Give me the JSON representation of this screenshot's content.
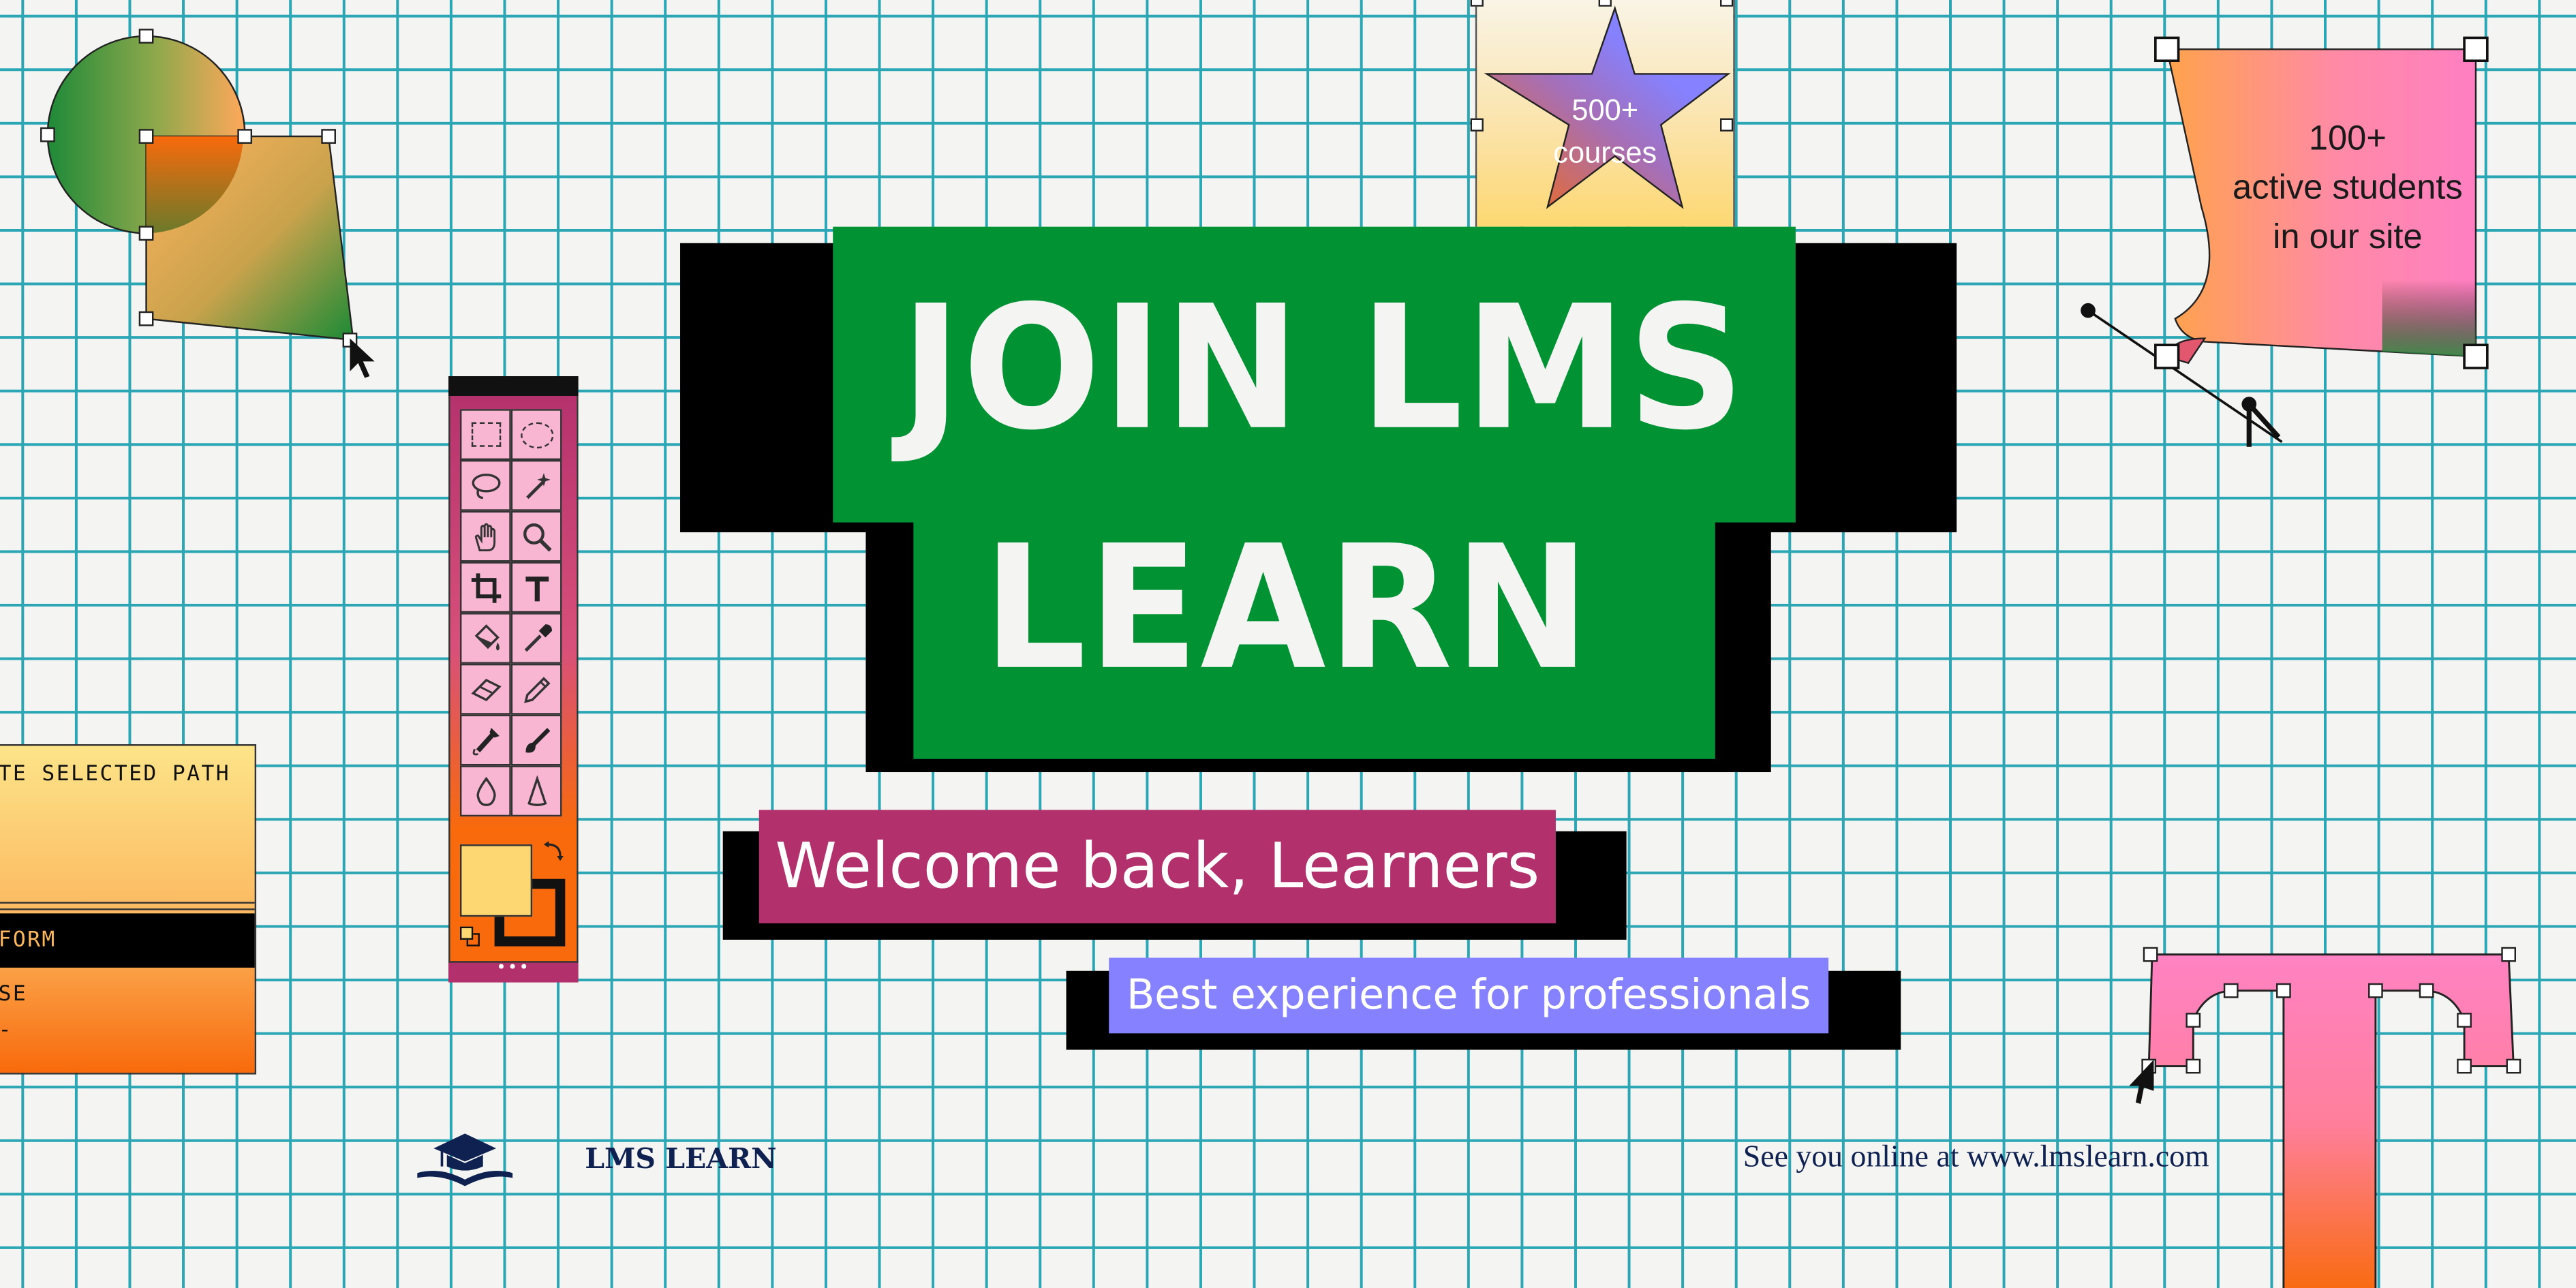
{
  "headline": {
    "line1": "JOIN LMS",
    "line2": "LEARN"
  },
  "welcome": "Welcome back, Learners",
  "tagline": "Best experience for professionals",
  "star_badge": {
    "line1": "500+",
    "line2": "courses"
  },
  "flag_badge": {
    "line1": "100+",
    "line2": "active students",
    "line3": "in our site"
  },
  "side_menu": {
    "item1": "TE SELECTED PATH",
    "item2": "FORM",
    "item3": "SE",
    "item4": "-"
  },
  "toolbar": {
    "more": "•••"
  },
  "brand": {
    "name": "LMS LEARN"
  },
  "footer": {
    "text": "See you online at www.lmslearn.com"
  },
  "colors": {
    "grid": "#2aa6b4",
    "green": "#019234",
    "magenta": "#b2306c",
    "violet": "#8581ff",
    "pink": "#ff82c3",
    "orange": "#f86a0c",
    "yellow": "#fdd872",
    "navy": "#0f2150"
  }
}
